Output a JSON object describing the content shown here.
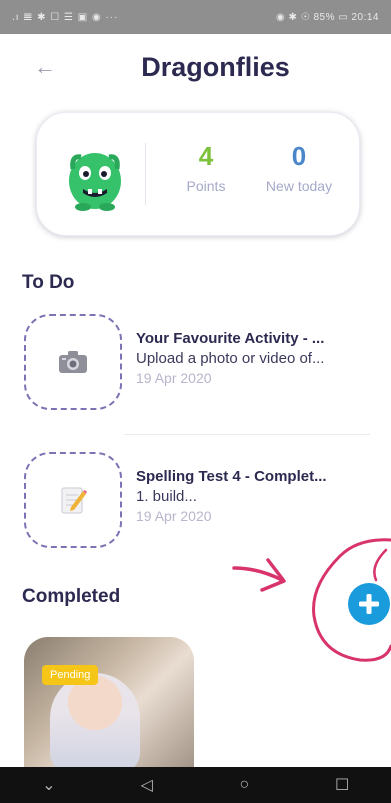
{
  "statusbar": {
    "left": ".ı 𝌆 ✱ ☐ ☰ ▣ ◉ ···",
    "right": "◉ ✱ ☉ 85% ▭ 20:14"
  },
  "header": {
    "title": "Dragonflies"
  },
  "stats": {
    "points_value": "4",
    "points_label": "Points",
    "new_value": "0",
    "new_label": "New today"
  },
  "sections": {
    "todo": "To Do",
    "completed": "Completed"
  },
  "todo_items": [
    {
      "title": "Your Favourite Activity - ...",
      "desc": "Upload a photo or video of...",
      "date": "19 Apr 2020",
      "icon": "camera-icon"
    },
    {
      "title": "Spelling Test 4 - Complet...",
      "desc": "1. build...",
      "date": "19 Apr 2020",
      "icon": "notepad-pencil-icon"
    }
  ],
  "completed_items": [
    {
      "badge": "Pending"
    }
  ],
  "colors": {
    "accent_green": "#7bc23a",
    "accent_blue": "#4a86c8",
    "fab_blue": "#1a9bdc",
    "annotation_pink": "#d8336c",
    "dashed_purple": "#7d72b3"
  }
}
